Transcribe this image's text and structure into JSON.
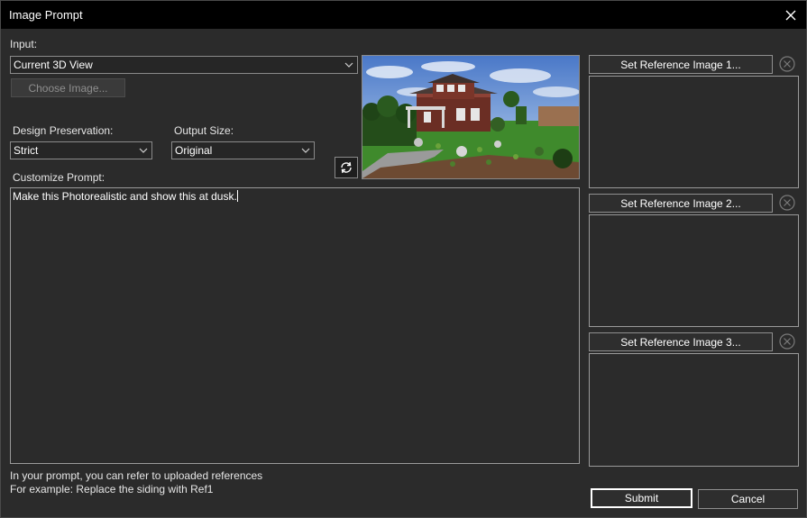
{
  "window": {
    "title": "Image Prompt"
  },
  "input": {
    "label": "Input:",
    "selected": "Current 3D View",
    "choose_image_label": "Choose Image..."
  },
  "design_preservation": {
    "label": "Design Preservation:",
    "selected": "Strict"
  },
  "output_size": {
    "label": "Output Size:",
    "selected": "Original"
  },
  "prompt": {
    "label": "Customize Prompt:",
    "value": "Make this Photorealistic and show this at dusk."
  },
  "references": [
    {
      "button_label": "Set Reference Image 1..."
    },
    {
      "button_label": "Set Reference Image 2..."
    },
    {
      "button_label": "Set Reference Image 3..."
    }
  ],
  "hint": {
    "line1": "In your prompt, you can refer to uploaded references",
    "line2": "For example: Replace the siding with Ref1"
  },
  "actions": {
    "submit_label": "Submit",
    "cancel_label": "Cancel"
  },
  "colors": {
    "titlebar": "#000000",
    "background": "#2b2b2b",
    "border": "#8a8a8a",
    "submit_border": "#ffffff"
  },
  "icons": {
    "close": "close-icon",
    "refresh": "refresh-icon",
    "dropdown": "chevron-down-icon",
    "clear": "clear-circle-icon"
  }
}
